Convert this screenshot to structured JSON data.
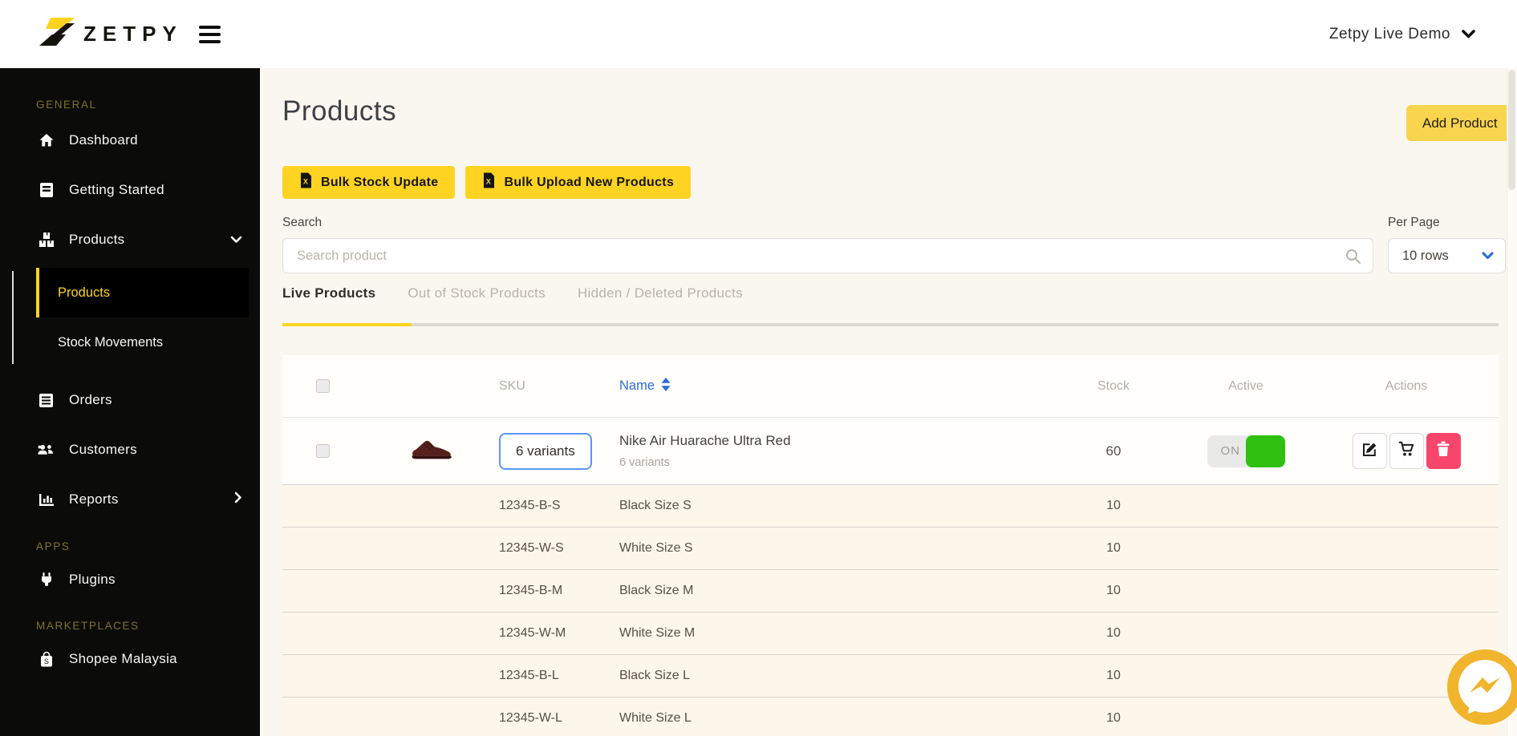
{
  "header": {
    "brand": "ZETPY",
    "account_label": "Zetpy Live Demo"
  },
  "sidebar": {
    "section_general": "GENERAL",
    "dashboard": "Dashboard",
    "getting_started": "Getting Started",
    "products": "Products",
    "submenu": {
      "products": "Products",
      "stock_movements": "Stock Movements"
    },
    "orders": "Orders",
    "customers": "Customers",
    "reports": "Reports",
    "section_apps": "APPS",
    "plugins": "Plugins",
    "section_marketplaces": "MARKETPLACES",
    "shopee": "Shopee Malaysia"
  },
  "page": {
    "title": "Products",
    "add_product": "Add Product",
    "bulk_stock_update": "Bulk Stock Update",
    "bulk_upload": "Bulk Upload New Products",
    "search_label": "Search",
    "search_placeholder": "Search product",
    "per_page_label": "Per Page",
    "per_page_value": "10 rows",
    "tabs": [
      {
        "label": "Live Products"
      },
      {
        "label": "Out of Stock Products"
      },
      {
        "label": "Hidden / Deleted Products"
      }
    ]
  },
  "table": {
    "columns": {
      "sku": "SKU",
      "name": "Name",
      "stock": "Stock",
      "active": "Active",
      "actions": "Actions"
    },
    "product": {
      "variants_button": "6 variants",
      "name": "Nike Air Huarache Ultra Red",
      "subtitle": "6 variants",
      "stock": "60",
      "toggle_state": "ON"
    },
    "variants": [
      {
        "sku": "12345-B-S",
        "name": "Black Size S",
        "stock": "10"
      },
      {
        "sku": "12345-W-S",
        "name": "White Size S",
        "stock": "10"
      },
      {
        "sku": "12345-B-M",
        "name": "Black Size M",
        "stock": "10"
      },
      {
        "sku": "12345-W-M",
        "name": "White Size M",
        "stock": "10"
      },
      {
        "sku": "12345-B-L",
        "name": "Black Size L",
        "stock": "10"
      },
      {
        "sku": "12345-W-L",
        "name": "White Size L",
        "stock": "10"
      }
    ]
  },
  "icons": {
    "hamburger": "three-bars",
    "chevron_down": "v-shape",
    "chevron_right": ">-shape",
    "search": "magnifier",
    "sort": "up-down-triangles",
    "excel_file": "file-with-X",
    "edit": "pencil-square",
    "cart": "shopping-cart",
    "trash": "trash-can",
    "messenger": "lightning-chat-bubble"
  },
  "colors": {
    "accent_yellow": "#fdd321",
    "add_product_yellow": "#f9d44f",
    "sidebar_bg": "#0b0b09",
    "section_label": "#7f722c",
    "link_blue": "#2e6bd6",
    "toggle_green": "#2fc011",
    "danger_pink": "#f8456b",
    "messenger_yellow": "#f0b42d",
    "page_bg": "#faf7f0",
    "variant_row_bg": "#fcf7ea"
  }
}
